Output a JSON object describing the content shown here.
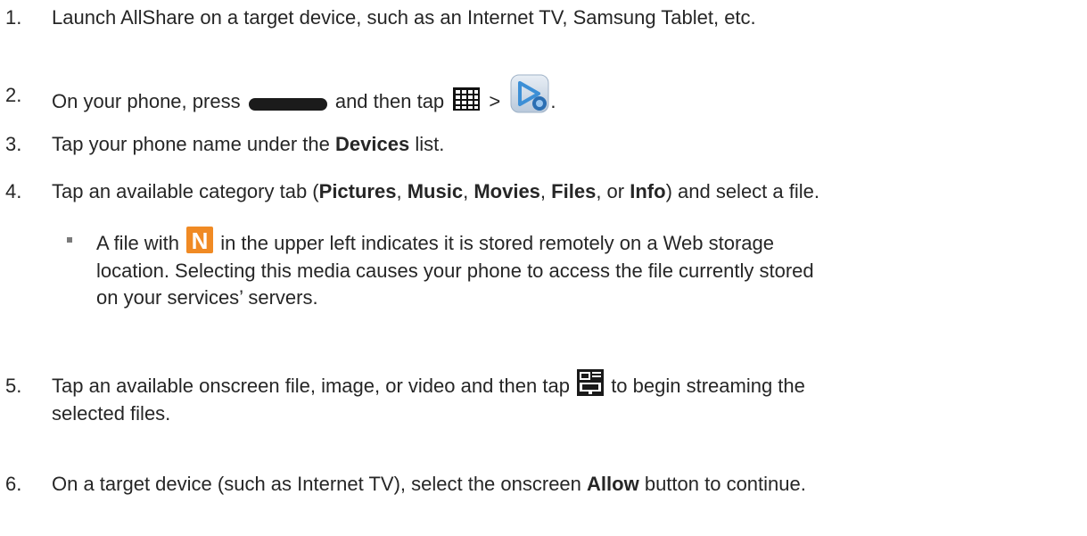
{
  "steps": [
    {
      "num": "1.",
      "text": "Launch AllShare on a target device, such as an Internet TV, Samsung Tablet, etc."
    },
    {
      "num": "2.",
      "a": "On your phone, press",
      "b": "and then tap",
      "c": ">",
      "d": "."
    },
    {
      "num": "3.",
      "a": "Tap your phone name under the",
      "b": "Devices",
      "c": "list."
    },
    {
      "num": "4.",
      "a": "Tap an available category tab (",
      "b": "Pictures",
      "c": ",",
      "d": "Music",
      "e": ",",
      "f": "Movies",
      "g": ",",
      "h": "Files",
      "i": ", or",
      "j": "Info",
      "k": ") and select a file."
    },
    {
      "num": "5.",
      "line1a": "Tap an available onscreen file, image, or video and then tap",
      "line1b": "to begin streaming the",
      "line2": "selected files."
    },
    {
      "num": "6.",
      "a": "On a target device (such as Internet TV), select the onscreen",
      "b": "Allow",
      "c": "button to continue."
    }
  ],
  "note": {
    "line1a": "A file with",
    "line1b": "in the upper left indicates it is stored remotely on a Web storage",
    "line2": "location. Selecting this media causes your phone to access the file currently stored",
    "line3": "on your services’ servers.",
    "icon_letter": "N"
  },
  "icons": {
    "home": "home-key-icon",
    "apps": "apps-grid-icon",
    "allshare": "allshare-app-icon",
    "web_storage": "web-storage-n-icon",
    "play_to": "play-to-device-icon"
  },
  "colors": {
    "text": "#262626",
    "n_badge": "#f08a24",
    "allshare_blue": "#3c8fd6"
  }
}
